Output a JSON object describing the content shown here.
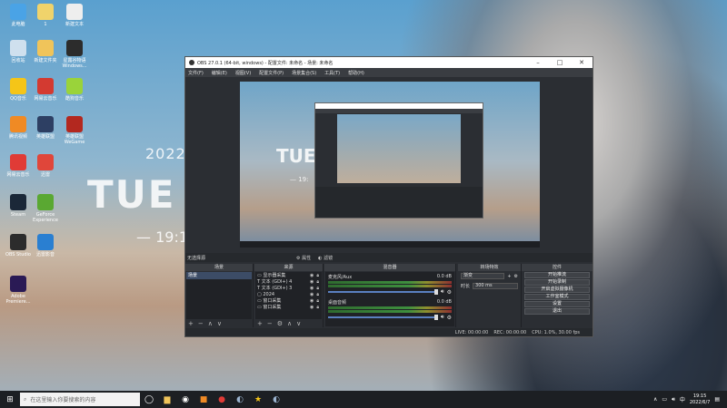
{
  "wallpaper": {
    "year": "2022",
    "day": "TUE",
    "time": "— 19:1"
  },
  "desktop_icons": [
    {
      "label": "此电脑",
      "color": "#4aa3e6"
    },
    {
      "label": "1",
      "color": "#f0d36b"
    },
    {
      "label": "新建文本",
      "color": "#eeeeee"
    },
    {
      "label": "回收站",
      "color": "#cfe0ee"
    },
    {
      "label": "新建文件夹",
      "color": "#f0c45a"
    },
    {
      "label": "星露谷物语 Windows...",
      "color": "#2c2c2c"
    },
    {
      "label": "QQ音乐",
      "color": "#f5c518"
    },
    {
      "label": "网易云音乐",
      "color": "#d33a31"
    },
    {
      "label": "酷狗音乐",
      "color": "#9ad33a"
    },
    {
      "label": "腾讯视频",
      "color": "#f08a24"
    },
    {
      "label": "英雄联盟",
      "color": "#2d3f63"
    },
    {
      "label": "英雄联盟WeGame",
      "color": "#b3281f"
    },
    {
      "label": "网易云音乐",
      "color": "#e03b36"
    },
    {
      "label": "迅雷",
      "color": "#e0463a"
    },
    {
      "label": "Steam",
      "color": "#1b2838"
    },
    {
      "label": "GeForce Experience",
      "color": "#5aa832"
    },
    {
      "label": "OBS Studio",
      "color": "#2c2c2c"
    },
    {
      "label": "迅雷影音",
      "color": "#2a7fd1"
    },
    {
      "label": "Adobe Premiere...",
      "color": "#2a1a55"
    }
  ],
  "obs": {
    "title": "OBS 27.0.1 (64-bit, windows) - 配置文件: 未命名 - 场景: 未命名",
    "menu": [
      "文件(F)",
      "编辑(E)",
      "视图(V)",
      "配置文件(P)",
      "场景集合(S)",
      "工具(T)",
      "帮助(H)"
    ],
    "context_bar": {
      "label": "无选择源",
      "properties": "属性",
      "filters": "滤镜"
    },
    "scenes": {
      "title": "场景",
      "items": [
        "场景"
      ]
    },
    "sources": {
      "title": "来源",
      "items": [
        "显示器采集",
        "文本 (GDI+) 4",
        "文本 (GDI+) 3",
        "2024",
        "窗口采集",
        "窗口采集"
      ]
    },
    "mixer": {
      "title": "混音器",
      "channels": [
        {
          "name": "麦克风/Aux",
          "db": "0.0 dB"
        },
        {
          "name": "桌面音频",
          "db": "0.0 dB"
        }
      ]
    },
    "transitions": {
      "title": "转场特效",
      "selected": "渐变",
      "duration_label": "时长",
      "duration_value": "300 ms"
    },
    "controls": {
      "title": "控件",
      "buttons": [
        "开始推流",
        "开始录制",
        "开启虚拟摄像机",
        "工作室模式",
        "设置",
        "退出"
      ]
    },
    "status": {
      "live": "LIVE: 00:00:00",
      "rec": "REC: 00:00:00",
      "cpu": "CPU: 1.0%, 30.00 fps"
    }
  },
  "taskbar": {
    "search_placeholder": "在这里输入你要搜索的内容",
    "time": "19:15",
    "date": "2022/6/7",
    "input_method": "中"
  }
}
